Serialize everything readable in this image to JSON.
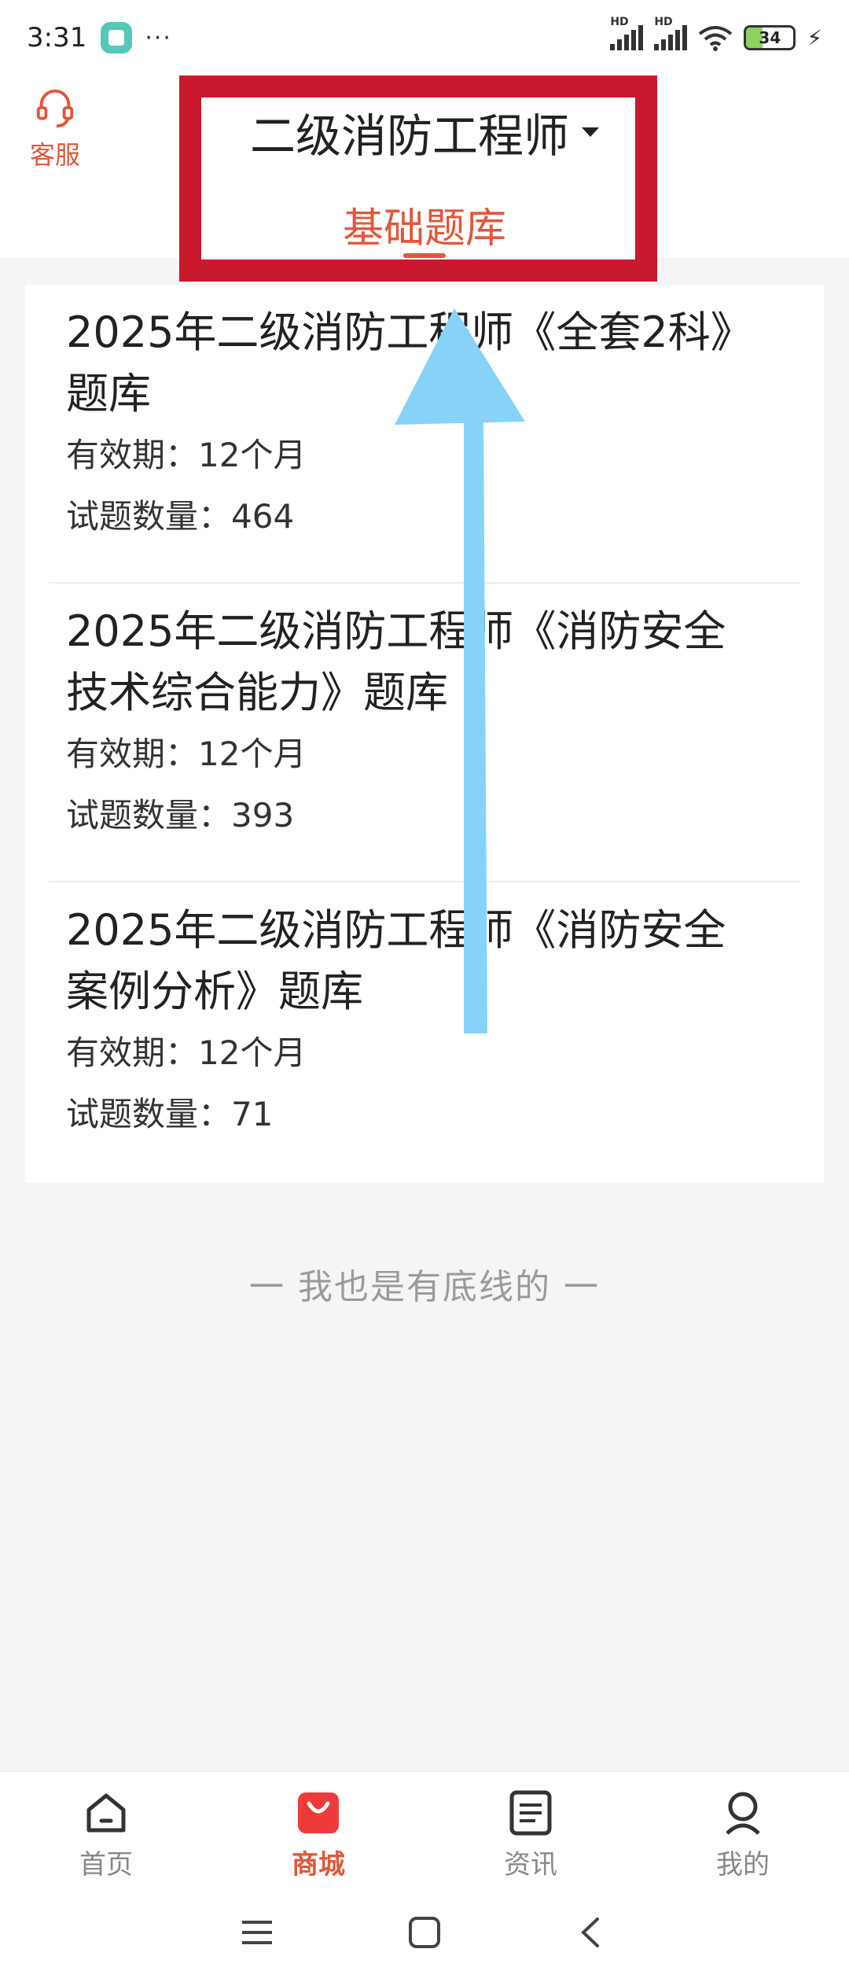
{
  "status_bar": {
    "time": "3:31",
    "more": "···",
    "signal_label_1": "HD",
    "signal_label_2": "HD",
    "battery": "34",
    "battery_level_percent": 34,
    "battery_color": "#8dd160"
  },
  "header": {
    "customer_service_label": "客服",
    "title": "二级消防工程师",
    "active_tab": "基础题库",
    "accent_color": "#e0573a",
    "highlight_color": "#c8192e"
  },
  "list": {
    "items": [
      {
        "title_line1": "2025年二级消防工程师《全套2科》",
        "title_line2": "题库",
        "validity": "有效期：12个月",
        "question_count": "试题数量：464"
      },
      {
        "title_line1": "2025年二级消防工程师《消防安全",
        "title_line2": "技术综合能力》题库",
        "validity": "有效期：12个月",
        "question_count": "试题数量：393"
      },
      {
        "title_line1": "2025年二级消防工程师《消防安全",
        "title_line2": "案例分析》题库",
        "validity": "有效期：12个月",
        "question_count": "试题数量：71"
      }
    ],
    "end_note": "一  我也是有底线的  一"
  },
  "bottom_nav": {
    "items": [
      {
        "label": "首页",
        "icon": "home-icon"
      },
      {
        "label": "商城",
        "icon": "shopping-bag-icon"
      },
      {
        "label": "资讯",
        "icon": "news-icon"
      },
      {
        "label": "我的",
        "icon": "profile-icon"
      }
    ],
    "active_index": 1
  },
  "system_nav": {
    "icons": [
      "menu-icon",
      "home-square-icon",
      "back-icon"
    ]
  },
  "overlay": {
    "arrow_color": "#87d3f8",
    "arrow_direction": "up"
  }
}
